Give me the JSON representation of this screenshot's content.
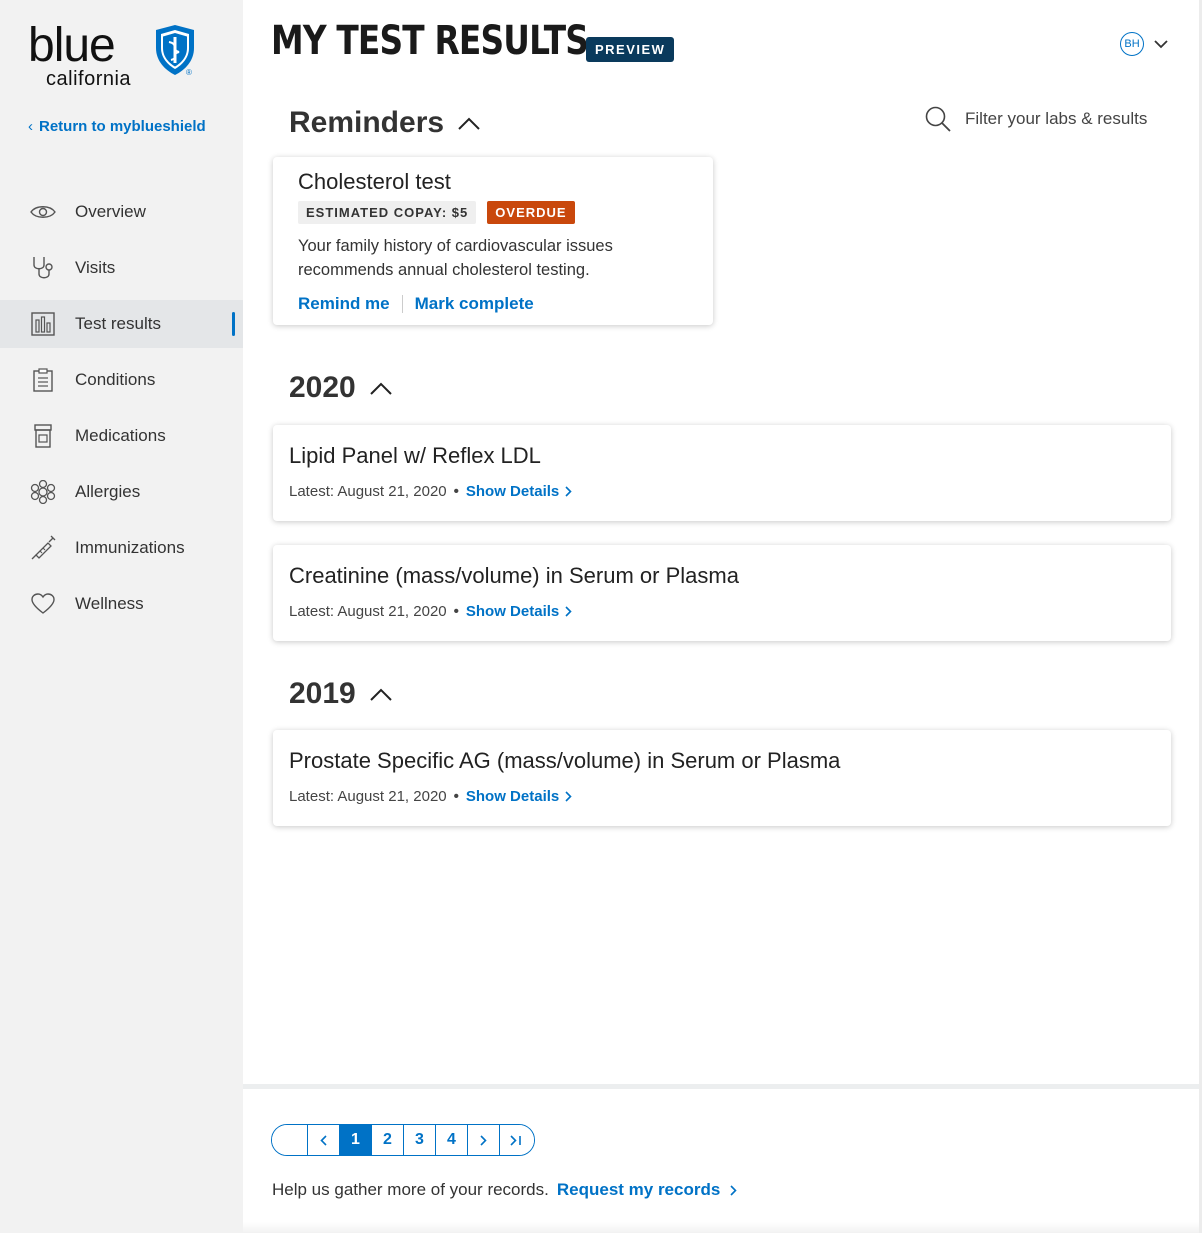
{
  "brand": {
    "logo_word": "blue",
    "logo_sub": "california"
  },
  "sidebar": {
    "return_label": "Return to myblueshield",
    "items": [
      {
        "label": "Overview",
        "icon": "eye-icon"
      },
      {
        "label": "Visits",
        "icon": "stethoscope-icon"
      },
      {
        "label": "Test results",
        "icon": "bar-chart-icon",
        "active": true
      },
      {
        "label": "Conditions",
        "icon": "clipboard-icon"
      },
      {
        "label": "Medications",
        "icon": "pill-bottle-icon"
      },
      {
        "label": "Allergies",
        "icon": "pollen-icon"
      },
      {
        "label": "Immunizations",
        "icon": "syringe-icon"
      },
      {
        "label": "Wellness",
        "icon": "heart-icon"
      }
    ]
  },
  "header": {
    "title": "MY TEST RESULTS",
    "badge": "PREVIEW",
    "user_initials": "BH"
  },
  "filter": {
    "placeholder": "Filter your labs & results"
  },
  "reminders": {
    "title": "Reminders",
    "card": {
      "title": "Cholesterol test",
      "copay": "ESTIMATED COPAY: $5",
      "status": "OVERDUE",
      "description": "Your family history of cardiovascular issues recommends annual cholesterol testing.",
      "remind_label": "Remind me",
      "complete_label": "Mark complete"
    }
  },
  "sections": [
    {
      "year": "2020",
      "results": [
        {
          "title": "Lipid Panel w/ Reflex LDL",
          "latest": "Latest: August 21, 2020",
          "details_label": "Show Details"
        },
        {
          "title": "Creatinine (mass/volume) in Serum or Plasma",
          "latest": "Latest: August 21, 2020",
          "details_label": "Show Details"
        }
      ]
    },
    {
      "year": "2019",
      "results": [
        {
          "title": "Prostate Specific AG (mass/volume) in Serum or Plasma",
          "latest": "Latest: August 21, 2020",
          "details_label": "Show Details"
        }
      ]
    }
  ],
  "pagination": {
    "pages": [
      "1",
      "2",
      "3",
      "4"
    ],
    "current": "1"
  },
  "footer": {
    "help_text": "Help us gather more of your records.",
    "request_label": "Request my records"
  },
  "colors": {
    "accent": "#0072c6",
    "badge_dark": "#0a3a5c",
    "overdue": "#c9480c",
    "sidebar_bg": "#f2f2f2"
  }
}
